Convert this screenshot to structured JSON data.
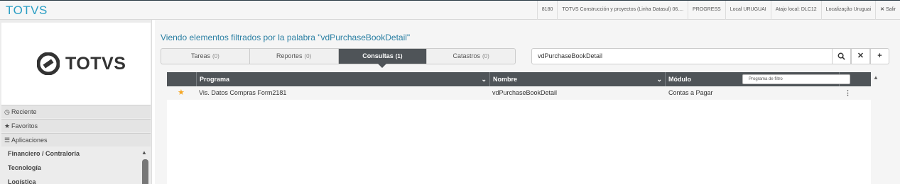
{
  "app": {
    "brand": "TOTVS"
  },
  "topbar": {
    "items": [
      {
        "label": "8180"
      },
      {
        "label": "TOTVS Construcción y proyectos (Linha Datasul) 06...."
      },
      {
        "label": "PROGRESS"
      },
      {
        "label": "Local URUGUAI"
      },
      {
        "label": "Atajo local: DLC12"
      },
      {
        "label": "Localização Uruguai"
      }
    ],
    "exit_label": "Salir"
  },
  "sidebar": {
    "logo_text": "TOTVS",
    "sections": [
      {
        "label": "Reciente",
        "icon": "clock-icon"
      },
      {
        "label": "Favoritos",
        "icon": "star-icon"
      },
      {
        "label": "Aplicaciones",
        "icon": "list-icon"
      }
    ],
    "items": [
      {
        "label": "Financiero / Contraloría"
      },
      {
        "label": "Tecnología"
      },
      {
        "label": "Logística"
      }
    ]
  },
  "main": {
    "title": "Viendo elementos filtrados por la palabra \"vdPurchaseBookDetail\"",
    "tabs": [
      {
        "label": "Tareas",
        "count": "(0)",
        "active": false
      },
      {
        "label": "Reportes",
        "count": "(0)",
        "active": false
      },
      {
        "label": "Consultas",
        "count": "(1)",
        "active": true
      },
      {
        "label": "Catastros",
        "count": "(0)",
        "active": false
      }
    ],
    "search": {
      "value": "vdPurchaseBookDetail"
    }
  },
  "grid": {
    "columns": [
      "Programa",
      "Nombre",
      "Módulo"
    ],
    "filter_placeholder": "Programa de filtro",
    "rows": [
      {
        "programa": "Vis. Datos Compras Form2181",
        "nombre": "vdPurchaseBookDetail",
        "modulo": "Contas a Pagar",
        "favorite": true
      }
    ]
  },
  "colors": {
    "brand": "#2a9ec4",
    "header_dark": "#4f5458",
    "star": "#f5a623"
  }
}
